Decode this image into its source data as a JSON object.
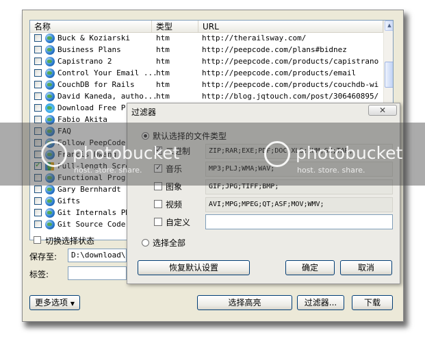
{
  "list": {
    "columns": [
      "名称",
      "类型",
      "URL"
    ],
    "rows": [
      {
        "name": "Buck & Koziarski",
        "type": "htm",
        "url": "http://therailsway.com/",
        "checked": false,
        "icon": "globe-icon"
      },
      {
        "name": "Business Plans",
        "type": "htm",
        "url": "http://peepcode.com/plans#bidnez",
        "checked": false,
        "icon": "globe-icon"
      },
      {
        "name": "Capistrano 2",
        "type": "htm",
        "url": "http://peepcode.com/products/capistrano-2",
        "checked": false,
        "icon": "globe-icon"
      },
      {
        "name": "Control Your Email ...",
        "type": "htm",
        "url": "http://peepcode.com/products/email",
        "checked": false,
        "icon": "globe-icon"
      },
      {
        "name": "CouchDB for Rails",
        "type": "htm",
        "url": "http://peepcode.com/products/couchdb-wi...",
        "checked": false,
        "icon": "globe-icon"
      },
      {
        "name": "David Kaneda, autho...",
        "type": "htm",
        "url": "http://blog.jqtouch.com/post/306460895/...",
        "checked": false,
        "icon": "globe-icon"
      },
      {
        "name": "Download Free Pre",
        "type": "",
        "url": "",
        "checked": false,
        "icon": "special-globe-icon"
      },
      {
        "name": "Fabio Akita",
        "type": "",
        "url": "",
        "checked": false,
        "icon": "globe-icon"
      },
      {
        "name": "FAQ",
        "type": "",
        "url": "",
        "checked": false,
        "icon": "globe-icon"
      },
      {
        "name": "Follow PeepCode!",
        "type": "",
        "url": "",
        "checked": false,
        "icon": "globe-icon"
      },
      {
        "name": "Francis Hwang",
        "type": "",
        "url": "",
        "checked": false,
        "icon": "globe-icon"
      },
      {
        "name": "Full-length Scree",
        "type": "",
        "url": "",
        "checked": true,
        "icon": "book-icon"
      },
      {
        "name": "Functional Progra",
        "type": "",
        "url": "",
        "checked": false,
        "icon": "globe-icon"
      },
      {
        "name": "Gary Bernhardt",
        "type": "",
        "url": "",
        "checked": false,
        "icon": "globe-icon"
      },
      {
        "name": "Gifts",
        "type": "",
        "url": "",
        "checked": false,
        "icon": "globe-icon"
      },
      {
        "name": "Git Internals PDF",
        "type": "",
        "url": "",
        "checked": false,
        "icon": "globe-icon"
      },
      {
        "name": "Git Source Code C",
        "type": "",
        "url": "",
        "checked": false,
        "icon": "globe-icon"
      }
    ]
  },
  "toggle_label": "切换选择状态",
  "save_label": "保存至:",
  "save_value": "D:\\download\\",
  "tag_label": "标签:",
  "more_options": "更多选项",
  "select_highlight": "选择高亮",
  "filter_button": "过滤器...",
  "download_button": "下载",
  "dialog": {
    "title": "过滤器",
    "close": "✕",
    "radio_default": "默认选择的文件类型",
    "radio_all": "选择全部",
    "types": [
      {
        "label": "二进制",
        "exts": "ZIP;RAR;EXE;PDF;DOC;XLS;CHM;GZ;TAR;",
        "checked": true
      },
      {
        "label": "音乐",
        "exts": "MP3;PLJ;WMA;WAV;",
        "checked": true
      },
      {
        "label": "图象",
        "exts": "GIF;JPG;TIFF;BMP;",
        "checked": false
      },
      {
        "label": "视频",
        "exts": "AVI;MPG;MPEG;QT;ASF;MOV;WMV;",
        "checked": false
      }
    ],
    "custom_label": "自定义",
    "custom_value": "",
    "restore_button": "恢复默认设置",
    "ok_button": "确定",
    "cancel_button": "取消"
  },
  "watermark": {
    "brand": "photobucket",
    "tagline": "host. store. share."
  }
}
